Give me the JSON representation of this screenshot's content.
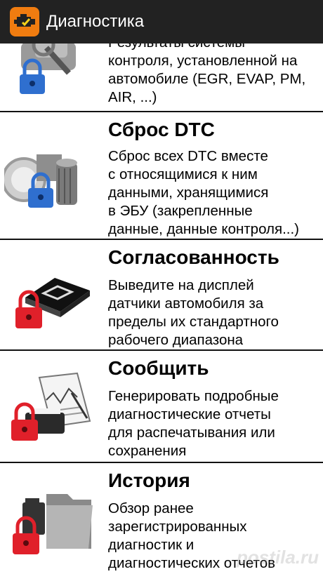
{
  "appbar": {
    "title": "Диагностика",
    "icon": "engine-check-icon"
  },
  "items": [
    {
      "title": "",
      "description": "Результаты системы\nконтроля, установленной на\nавтомобиле (EGR, EVAP, PM,\nAIR, ...)",
      "icon": "engine-monitor-lock-icon"
    },
    {
      "title": "Сброс DTC",
      "description": "Сброс всех DTC вместе\nс относящимися к ним\nданными, хранящимися\nв ЭБУ (закрепленные\nданные, данные контроля...)",
      "icon": "engine-parts-lock-icon"
    },
    {
      "title": "Согласованность",
      "description": "Выведите на дисплей\nдатчики автомобиля за\nпределы их стандартного\nрабочего диапазона",
      "icon": "chip-lock-icon"
    },
    {
      "title": "Сообщить",
      "description": "Генерировать подробные\nдиагностические отчеты\nдля распечатывания или\nсохранения",
      "icon": "report-printer-lock-icon"
    },
    {
      "title": "История",
      "description": "Обзор ранее\nзарегистрированных\nдиагностик и\nдиагностических отчетов",
      "icon": "folder-sdcard-lock-icon"
    }
  ],
  "colors": {
    "appbar": "#222222",
    "app_icon": "#f07c10",
    "lock_blue": "#2f6fcf",
    "lock_red": "#e0202a"
  },
  "watermark": "postila.ru"
}
